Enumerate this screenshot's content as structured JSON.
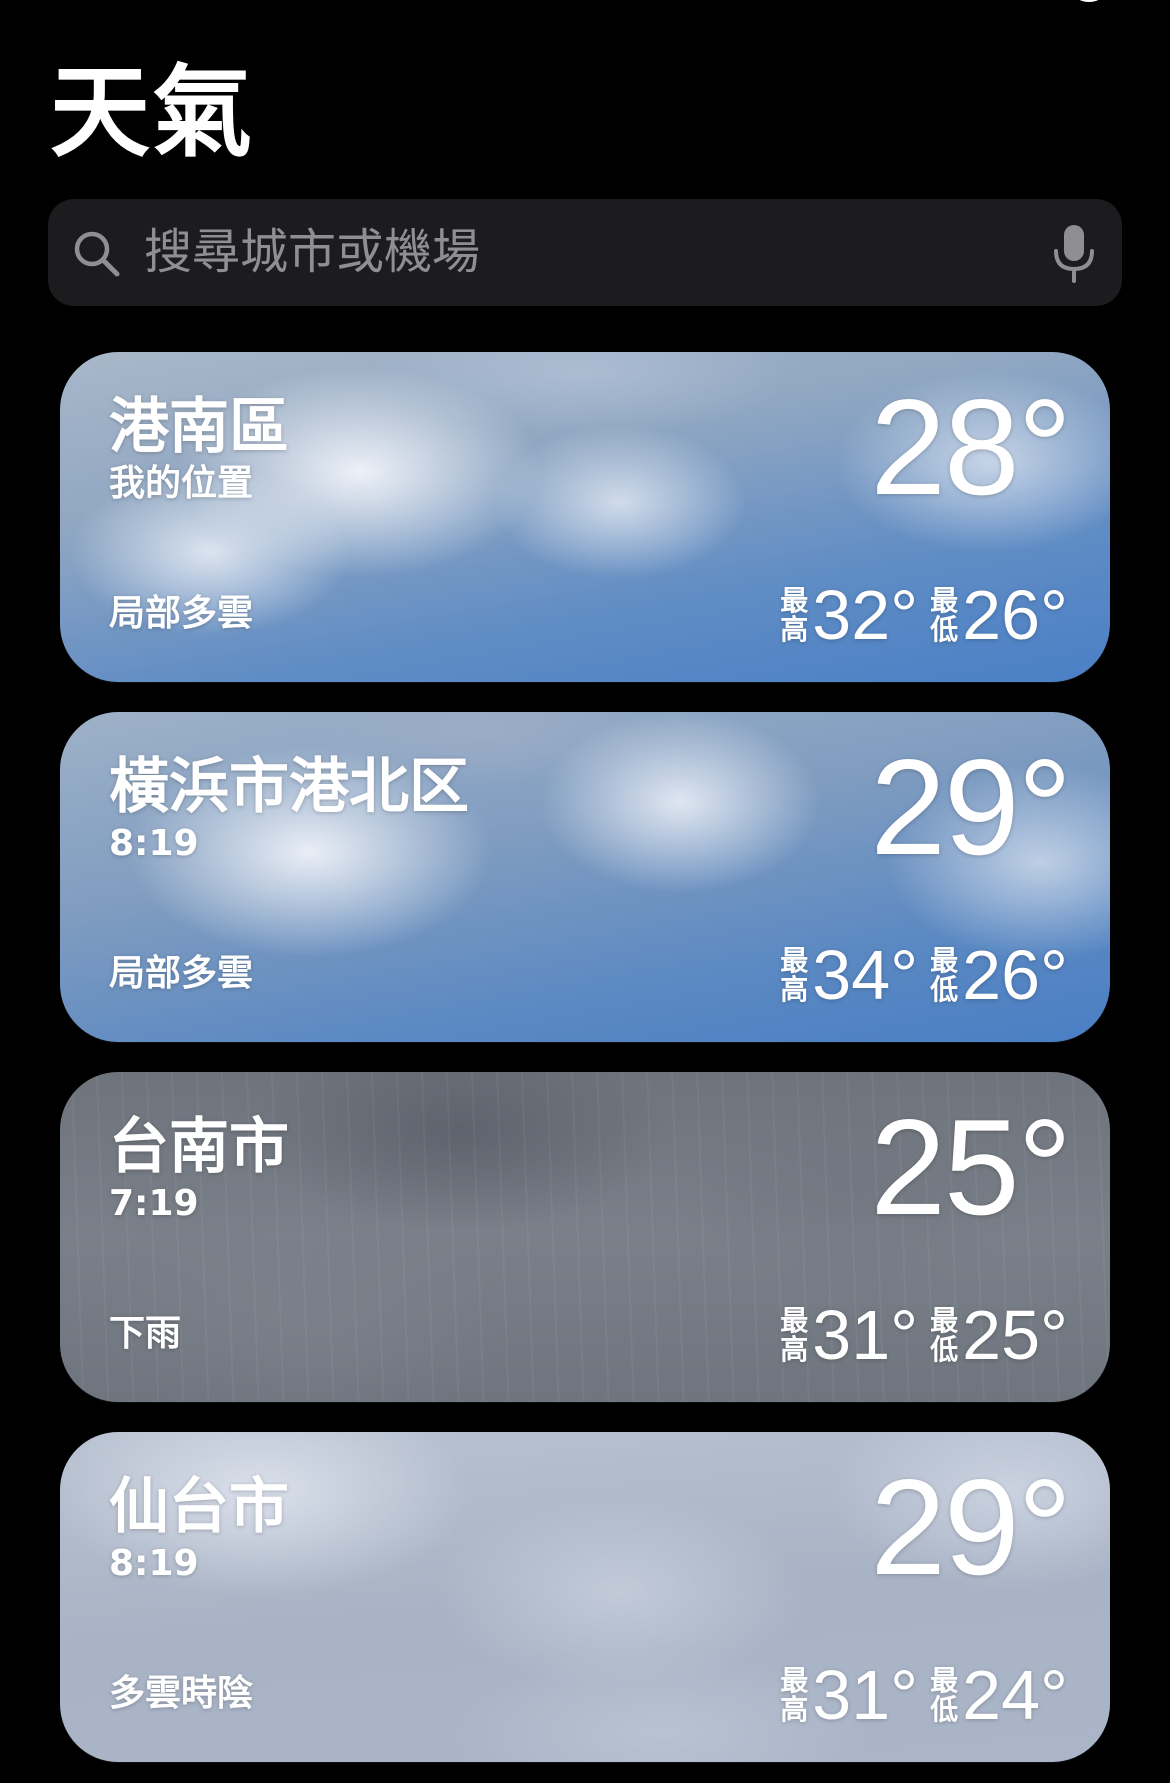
{
  "header": {
    "title": "天氣"
  },
  "search": {
    "placeholder": "搜尋城市或機場",
    "icon": "search-icon",
    "mic_icon": "microphone-icon"
  },
  "labels": {
    "high_top": "最",
    "high_bottom": "高",
    "low_top": "最",
    "low_bottom": "低"
  },
  "cards": [
    {
      "city": "港南區",
      "subtitle": "我的位置",
      "temp": "28°",
      "condition": "局部多雲",
      "high": "32°",
      "low": "26°"
    },
    {
      "city": "橫浜市港北区",
      "subtitle": "8:19",
      "temp": "29°",
      "condition": "局部多雲",
      "high": "34°",
      "low": "26°"
    },
    {
      "city": "台南市",
      "subtitle": "7:19",
      "temp": "25°",
      "condition": "下雨",
      "high": "31°",
      "low": "25°"
    },
    {
      "city": "仙台市",
      "subtitle": "8:19",
      "temp": "29°",
      "condition": "多雲時陰",
      "high": "31°",
      "low": "24°"
    }
  ]
}
